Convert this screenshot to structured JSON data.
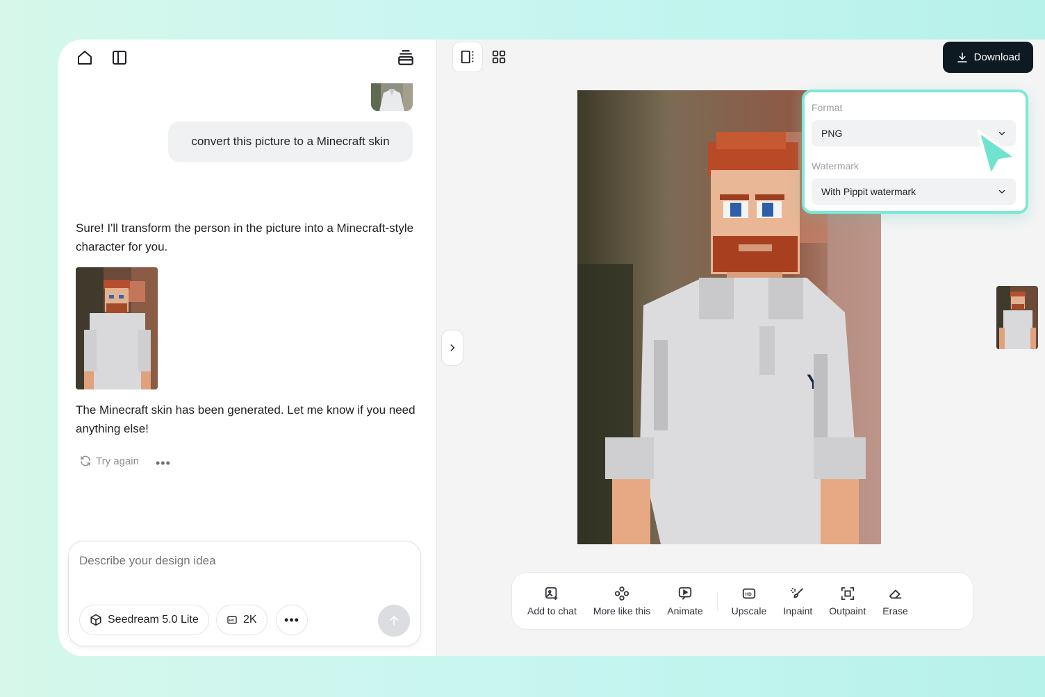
{
  "left_panel": {
    "user_message": "convert this picture to a Minecraft skin",
    "assistant_reply_1": "Sure! I'll transform the person in the picture into a Minecraft-style character for you.",
    "assistant_reply_2": "The Minecraft skin has been generated. Let me know if you need anything else!",
    "try_again_label": "Try again",
    "composer": {
      "placeholder": "Describe your design idea",
      "model_label": "Seedream 5.0 Lite",
      "resolution_label": "2K"
    }
  },
  "right_panel": {
    "download_label": "Download",
    "toolbar": [
      {
        "label": "Add to chat",
        "icon": "add-to-chat-icon"
      },
      {
        "label": "More like this",
        "icon": "more-like-this-icon"
      },
      {
        "label": "Animate",
        "icon": "animate-icon"
      },
      {
        "label": "Upscale",
        "icon": "hd-icon"
      },
      {
        "label": "Inpaint",
        "icon": "inpaint-brush-icon"
      },
      {
        "label": "Outpaint",
        "icon": "outpaint-icon"
      },
      {
        "label": "Erase",
        "icon": "eraser-icon"
      }
    ],
    "download_popup": {
      "format_label": "Format",
      "format_value": "PNG",
      "watermark_label": "Watermark",
      "watermark_value": "With Pippit watermark"
    }
  },
  "colors": {
    "accent_teal": "#7ee7d5",
    "download_bg": "#0e1a22",
    "background_gradient_start": "#d6f7ea"
  }
}
